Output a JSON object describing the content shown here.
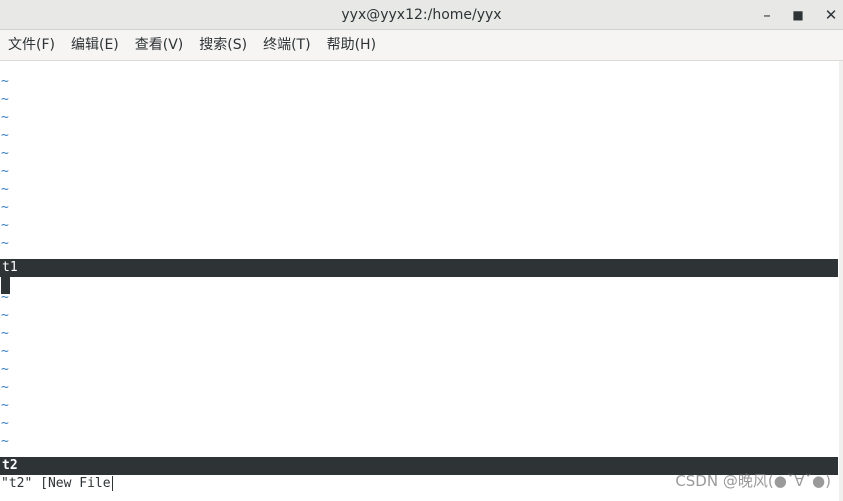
{
  "window": {
    "title": "yyx@yyx12:/home/yyx",
    "minimize_glyph": "–",
    "maximize_glyph": "■",
    "close_glyph": "✕"
  },
  "menubar": {
    "items": [
      {
        "label": "文件(F)"
      },
      {
        "label": "编辑(E)"
      },
      {
        "label": "查看(V)"
      },
      {
        "label": "搜索(S)"
      },
      {
        "label": "终端(T)"
      },
      {
        "label": "帮助(H)"
      }
    ]
  },
  "editor": {
    "tilde": "~",
    "top_window_status": "t1",
    "bottom_window_status": "t2",
    "command_line": "\"t2\" [New File"
  },
  "watermark": "CSDN @晚风(●ˇ∀ˇ●)",
  "colors": {
    "status_bar": "#2e3436",
    "tilde": "#3a7ec7",
    "titlebar": "#e8e8e7",
    "menubar": "#f6f5f4"
  }
}
